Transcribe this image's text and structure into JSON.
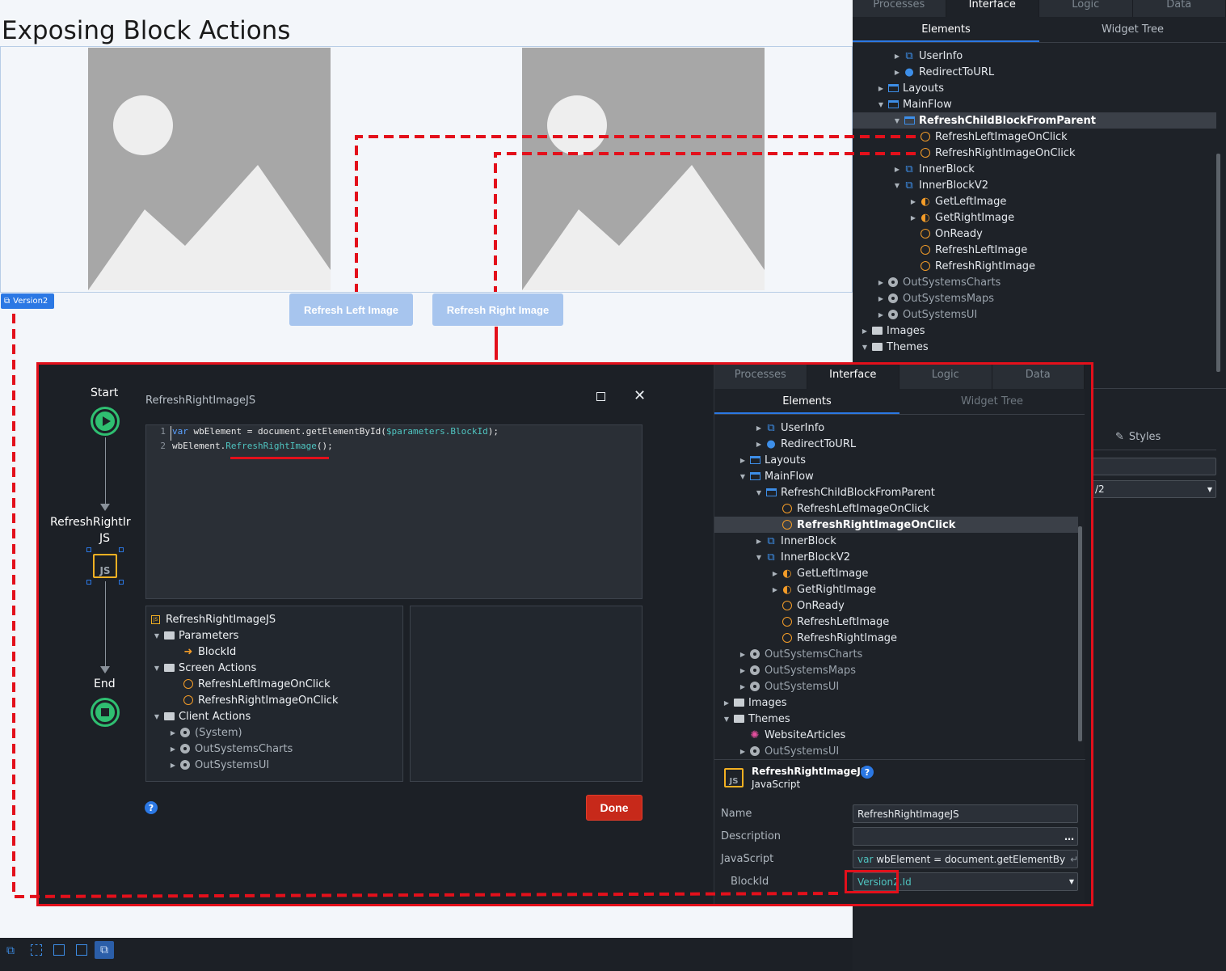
{
  "preview": {
    "title": "Exposing Block Actions",
    "block_tag": "Version2",
    "buttons": {
      "refresh_left": "Refresh Left Image",
      "refresh_right": "Refresh Right Image"
    }
  },
  "ide": {
    "tabs": [
      "Processes",
      "Interface",
      "Logic",
      "Data"
    ],
    "subtabs": [
      "Elements",
      "Widget Tree"
    ],
    "tree": [
      {
        "label": "UserInfo"
      },
      {
        "label": "RedirectToURL"
      },
      {
        "label": "Layouts"
      },
      {
        "label": "MainFlow"
      },
      {
        "label": "RefreshChildBlockFromParent"
      },
      {
        "label": "RefreshLeftImageOnClick"
      },
      {
        "label": "RefreshRightImageOnClick"
      },
      {
        "label": "InnerBlock"
      },
      {
        "label": "InnerBlockV2"
      },
      {
        "label": "GetLeftImage"
      },
      {
        "label": "GetRightImage"
      },
      {
        "label": "OnReady"
      },
      {
        "label": "RefreshLeftImage"
      },
      {
        "label": "RefreshRightImage"
      },
      {
        "label": "OutSystemsCharts"
      },
      {
        "label": "OutSystemsMaps"
      },
      {
        "label": "OutSystemsUI"
      },
      {
        "label": "Images"
      },
      {
        "label": "Themes"
      }
    ],
    "styles_label": "Styles",
    "dropdown_partial": "/2"
  },
  "modal": {
    "flow": {
      "start": "Start",
      "node": "RefreshRightImageJS",
      "node_line1": "RefreshRightIr",
      "node_line2": "JS",
      "node_badge": "JS",
      "end": "End"
    },
    "title": "RefreshRightImageJS",
    "code": {
      "line_numbers": [
        "1",
        "2"
      ],
      "line1_kw": "var",
      "line1_mid": " wbElement = document.getElementById(",
      "line1_param": "$parameters.BlockId",
      "line1_end": ");",
      "line2_pre": "wbElement.",
      "line2_fn": "RefreshRightImage",
      "line2_end": "();"
    },
    "params_tree": {
      "root": "RefreshRightImageJS",
      "parameters": "Parameters",
      "block_id": "BlockId",
      "screen_actions": "Screen Actions",
      "sa_left": "RefreshLeftImageOnClick",
      "sa_right": "RefreshRightImageOnClick",
      "client_actions": "Client Actions",
      "ca_system": "(System)",
      "ca_charts": "OutSystemsCharts",
      "ca_ui": "OutSystemsUI"
    },
    "done": "Done",
    "help": "?",
    "right": {
      "tabs": [
        "Processes",
        "Interface",
        "Logic",
        "Data"
      ],
      "subtabs": [
        "Elements",
        "Widget Tree"
      ],
      "tree": [
        {
          "label": "UserInfo"
        },
        {
          "label": "RedirectToURL"
        },
        {
          "label": "Layouts"
        },
        {
          "label": "MainFlow"
        },
        {
          "label": "RefreshChildBlockFromParent"
        },
        {
          "label": "RefreshLeftImageOnClick"
        },
        {
          "label": "RefreshRightImageOnClick"
        },
        {
          "label": "InnerBlock"
        },
        {
          "label": "InnerBlockV2"
        },
        {
          "label": "GetLeftImage"
        },
        {
          "label": "GetRightImage"
        },
        {
          "label": "OnReady"
        },
        {
          "label": "RefreshLeftImage"
        },
        {
          "label": "RefreshRightImage"
        },
        {
          "label": "OutSystemsCharts"
        },
        {
          "label": "OutSystemsMaps"
        },
        {
          "label": "OutSystemsUI"
        },
        {
          "label": "Images"
        },
        {
          "label": "Themes"
        },
        {
          "label": "WebsiteArticles"
        },
        {
          "label": "OutSystemsUI"
        }
      ],
      "props": {
        "element_name": "RefreshRightImageJS",
        "element_type": "JavaScript",
        "name_label": "Name",
        "name_value": "RefreshRightImageJS",
        "description_label": "Description",
        "description_value": "",
        "javascript_label": "JavaScript",
        "javascript_kw": "var",
        "javascript_value": " wbElement = document.getElementBy",
        "blockid_label": "BlockId",
        "blockid_value": "Version2.Id"
      }
    }
  },
  "colors": {
    "accent": "#2b78e4",
    "annotation": "#e3101b",
    "done": "#c7291a",
    "action": "#f39c28"
  }
}
